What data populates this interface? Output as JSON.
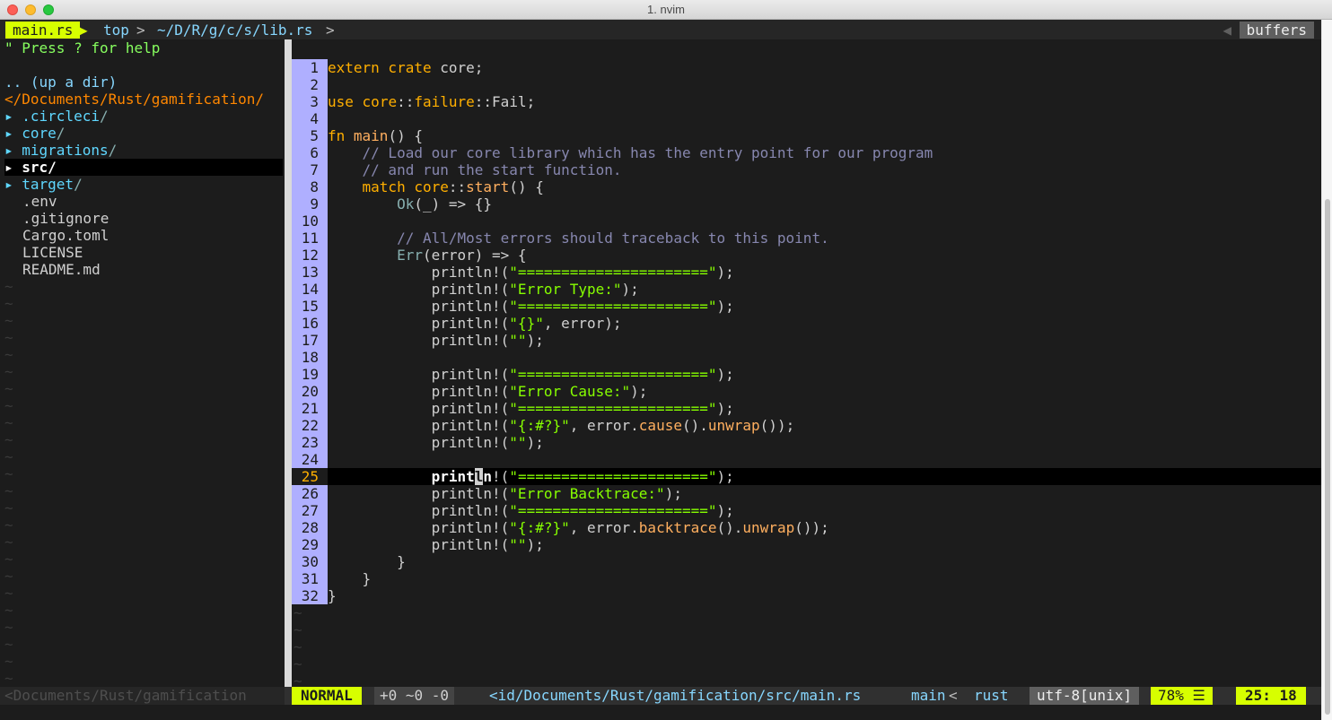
{
  "window": {
    "title": "1. nvim"
  },
  "tabline": {
    "file": "main.rs",
    "scope": "top",
    "path": "~/D/R/g/c/s/lib.rs",
    "buffers_label": "buffers"
  },
  "tree": {
    "help": "\" Press ? for help",
    "updir": ".. (up a dir)",
    "root": "</Documents/Rust/gamification/",
    "dirs": [
      ".circleci",
      "core",
      "migrations",
      "src",
      "target"
    ],
    "files": [
      ".env",
      ".gitignore",
      "Cargo.toml",
      "LICENSE",
      "README.md"
    ],
    "selected": "src"
  },
  "editor": {
    "current_line": 25,
    "line_count": 32
  },
  "statusline": {
    "left_path": "<Documents/Rust/gamification",
    "mode": "NORMAL",
    "hunks": "+0 ~0 -0",
    "path": "<id/Documents/Rust/gamification/src/main.rs",
    "branch": "main",
    "filetype": "rust",
    "encoding": "utf-8[unix]",
    "percent": "78%",
    "position": "25: 18"
  },
  "colors": {
    "accent": "#d7ff00",
    "gutter": "#afafff",
    "background": "#1c1c1c",
    "string": "#87ff00",
    "keyword": "#ffaf00",
    "comment": "#8787af"
  }
}
